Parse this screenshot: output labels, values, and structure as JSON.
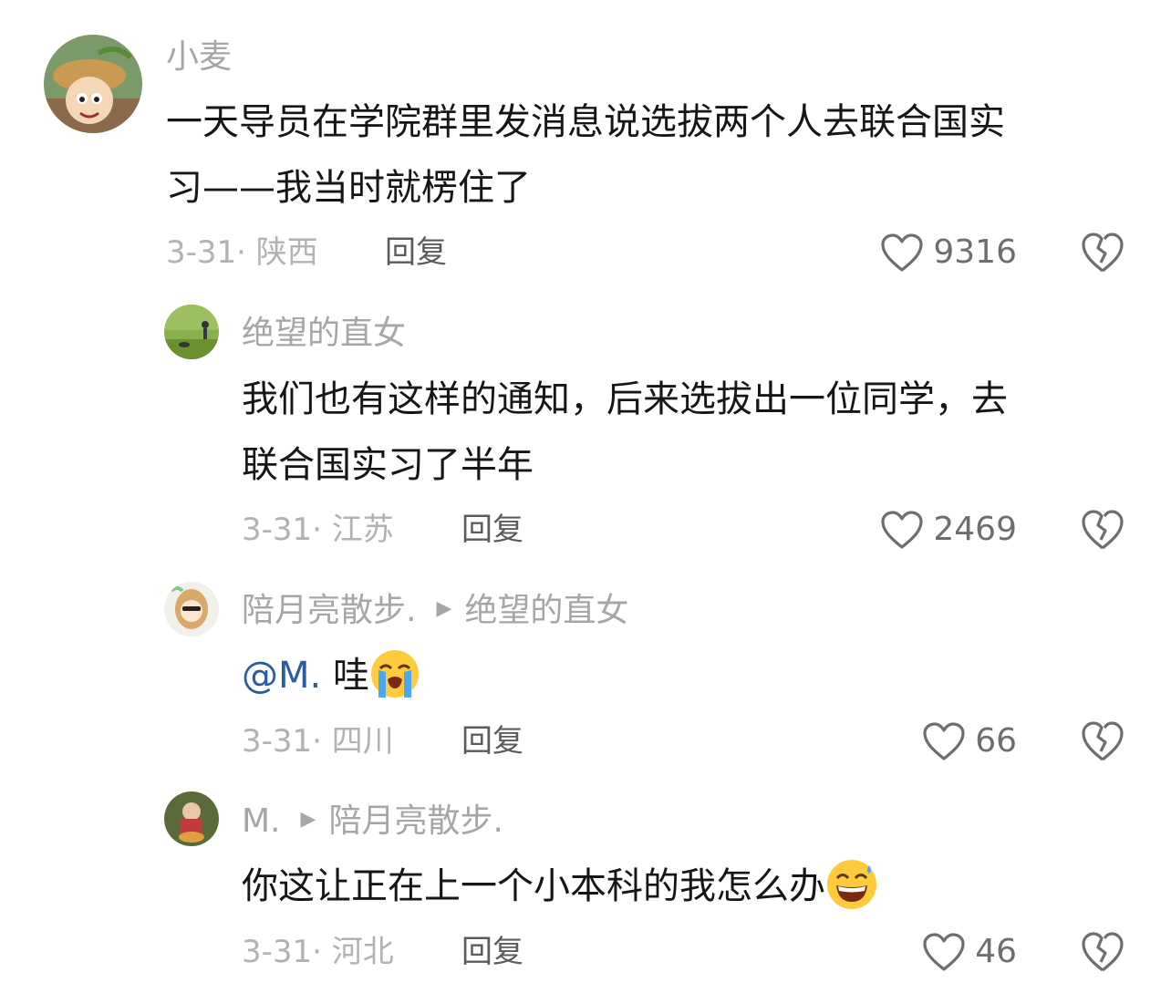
{
  "comments": [
    {
      "name": "小麦",
      "lines": [
        "一天导员在学院群里发消息说选拔两个人去联合国实",
        "习——我当时就楞住了"
      ],
      "date": "3-31·",
      "region": "陕西",
      "reply_label": "回复",
      "likes": "9316"
    },
    {
      "name": "绝望的直女",
      "lines": [
        "我们也有这样的通知，后来选拔出一位同学，去",
        "联合国实习了半年"
      ],
      "date": "3-31·",
      "region": "江苏",
      "reply_label": "回复",
      "likes": "2469"
    },
    {
      "name": "陪月亮散步.",
      "reply_to": "绝望的直女",
      "mention": "@M.",
      "text": " 哇",
      "emoji": "loudly-crying-face",
      "date": "3-31·",
      "region": "四川",
      "reply_label": "回复",
      "likes": "66"
    },
    {
      "name": "M.",
      "reply_to": "陪月亮散步.",
      "text": "你这让正在上一个小本科的我怎么办",
      "emoji": "grinning-sweat-face",
      "date": "3-31·",
      "region": "河北",
      "reply_label": "回复",
      "likes": "46"
    }
  ],
  "icons": {
    "like": "heart-outline-icon",
    "dislike": "broken-heart-icon"
  },
  "colors": {
    "mention": "#2a5d9f",
    "name": "#a6a6a6",
    "text": "#161616",
    "meta": "#b2b2b2"
  }
}
